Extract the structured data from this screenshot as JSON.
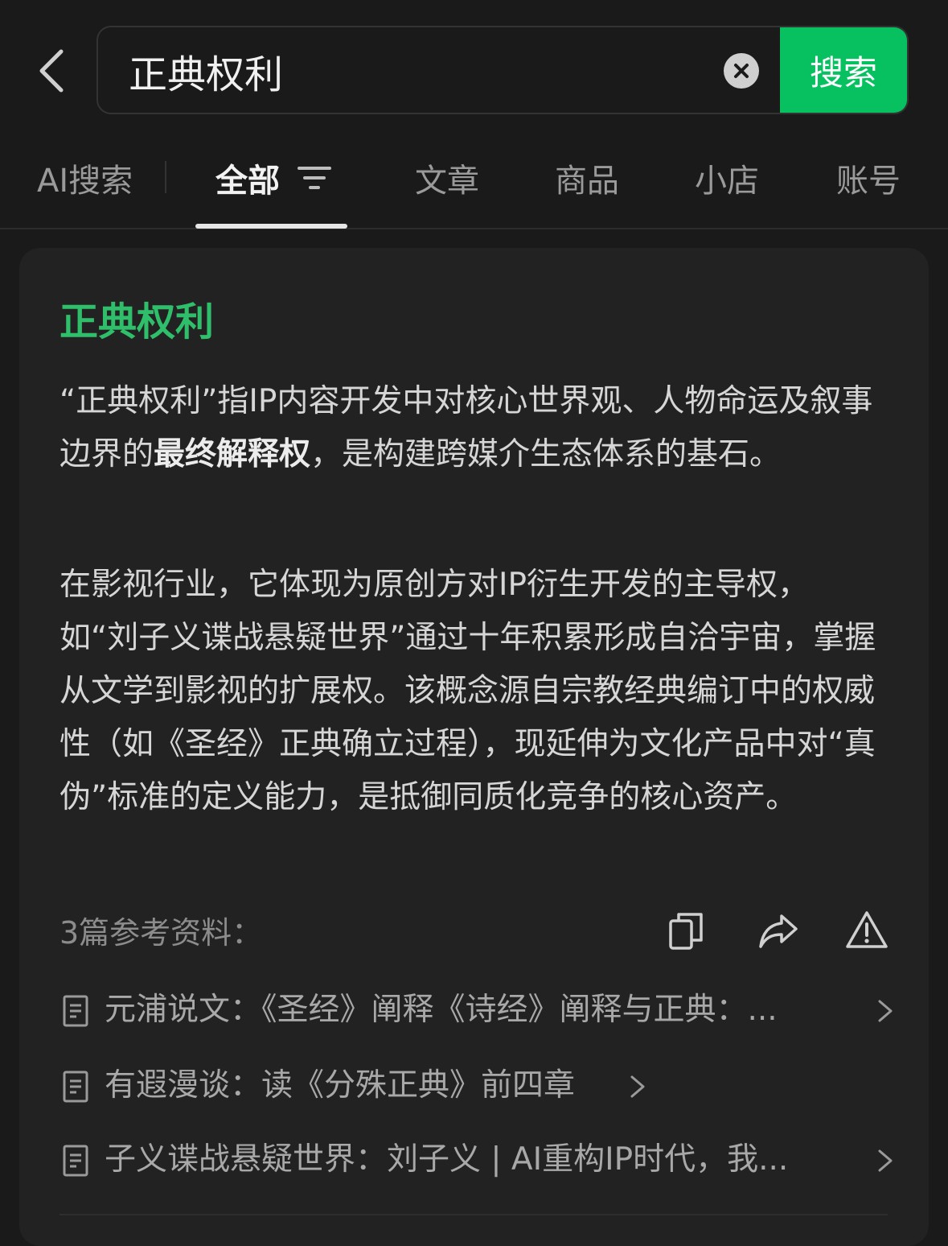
{
  "search": {
    "query": "正典权利",
    "button_label": "搜索"
  },
  "tabs": [
    {
      "label": "AI搜索"
    },
    {
      "label": "全部"
    },
    {
      "label": "文章"
    },
    {
      "label": "商品"
    },
    {
      "label": "小店"
    },
    {
      "label": "账号"
    }
  ],
  "card": {
    "title": "正典权利",
    "p1_pre": "“正典权利”指IP内容开发中对核心世界观、人物命运及叙事边界的",
    "p1_bold": "最终解释权",
    "p1_post": "，是构建跨媒介生态体系的基石。",
    "p2": "在影视行业，它体现为原创方对IP衍生开发的主导权，如“刘子义谍战悬疑世界”通过十年积累形成自洽宇宙，掌握从文学到影视的扩展权。该概念源自宗教经典编订中的权威性（如《圣经》正典确立过程），现延伸为文化产品中对“真伪”标准的定义能力，是抵御同质化竞争的核心资产。",
    "refs_label": "3篇参考资料：",
    "refs": [
      {
        "text": "元浦说文：《圣经》阐释《诗经》阐释与正典：..."
      },
      {
        "text": "有遐漫谈：读《分殊正典》前四章"
      },
      {
        "text": "子义谍战悬疑世界：刘子义 | AI重构IP时代，我..."
      }
    ]
  },
  "colors": {
    "accent": "#07c160",
    "title_green": "#2fbf6b",
    "background": "#1a1a1a",
    "card": "#222222"
  }
}
